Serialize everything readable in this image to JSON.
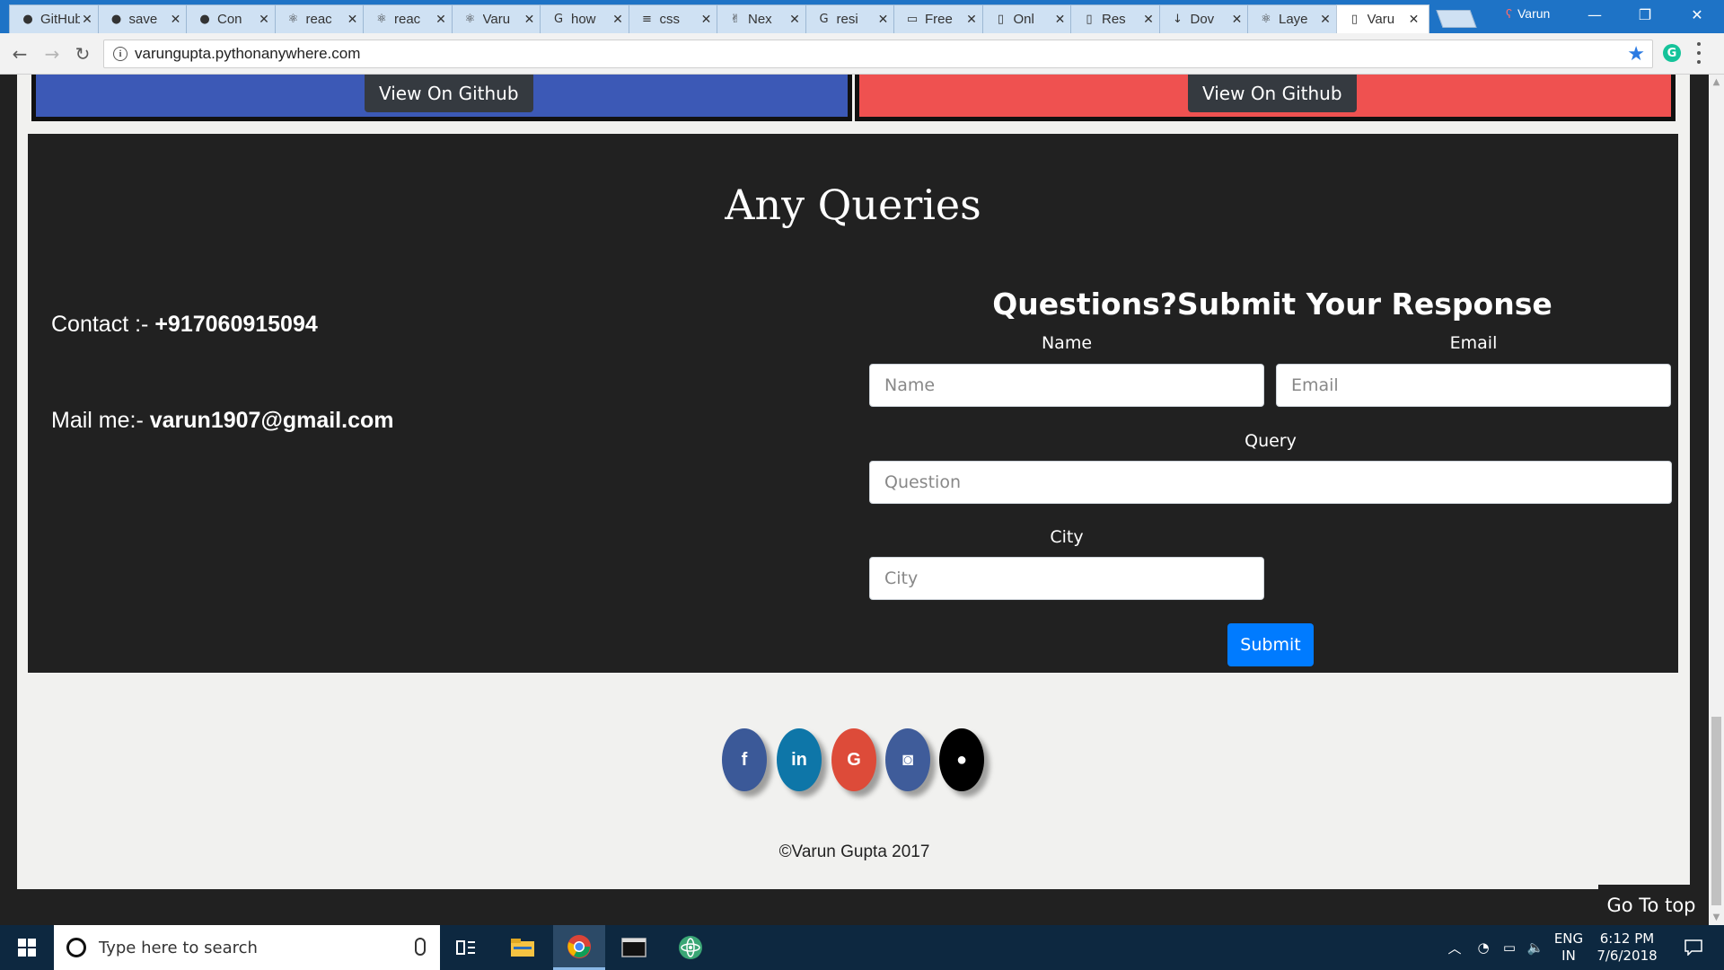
{
  "browser": {
    "tabs": [
      {
        "title": "GitHub",
        "icon": "github-icon"
      },
      {
        "title": "save",
        "icon": "github-icon"
      },
      {
        "title": "Con",
        "icon": "github-icon"
      },
      {
        "title": "reac",
        "icon": "react-icon"
      },
      {
        "title": "reac",
        "icon": "react-icon"
      },
      {
        "title": "Varu",
        "icon": "react-icon"
      },
      {
        "title": "how",
        "icon": "google-icon"
      },
      {
        "title": "css",
        "icon": "stackoverflow-icon"
      },
      {
        "title": "Nex",
        "icon": "hand-icon"
      },
      {
        "title": "resi",
        "icon": "google-icon"
      },
      {
        "title": "Free",
        "icon": "page-icon"
      },
      {
        "title": "Onl",
        "icon": "doc-icon"
      },
      {
        "title": "Res",
        "icon": "doc-icon"
      },
      {
        "title": "Dov",
        "icon": "download-icon"
      },
      {
        "title": "Laye",
        "icon": "react-icon"
      },
      {
        "title": "Varu",
        "icon": "doc-icon",
        "active": true
      }
    ],
    "profile_name": "Varun",
    "url": "varungupta.pythonanywhere.com"
  },
  "projects": {
    "left_button": "View On Github",
    "right_button": "View On Github"
  },
  "queries": {
    "title": "Any Queries",
    "contact_label": "Contact :-",
    "contact_value": "+917060915094",
    "mail_label": "Mail me:-",
    "mail_value": "varun1907@gmail.com",
    "form_title": "Questions?Submit Your Response",
    "name_label": "Name",
    "name_placeholder": "Name",
    "email_label": "Email",
    "email_placeholder": "Email",
    "query_label": "Query",
    "query_placeholder": "Question",
    "city_label": "City",
    "city_placeholder": "City",
    "submit_label": "Submit"
  },
  "footer": {
    "social": [
      {
        "name": "facebook",
        "glyph": "f",
        "color": "#3b5998"
      },
      {
        "name": "linkedin",
        "glyph": "in",
        "color": "#0e76a8"
      },
      {
        "name": "google",
        "glyph": "G",
        "color": "#dd4b39"
      },
      {
        "name": "instagram",
        "glyph": "◙",
        "color": "#3f5c9a"
      },
      {
        "name": "github",
        "glyph": "●",
        "color": "#000000"
      }
    ],
    "copyright": "©Varun Gupta 2017",
    "go_top": "Go To top"
  },
  "taskbar": {
    "search_placeholder": "Type here to search",
    "lang_top": "ENG",
    "lang_bottom": "IN",
    "time": "6:12 PM",
    "date": "7/6/2018"
  }
}
